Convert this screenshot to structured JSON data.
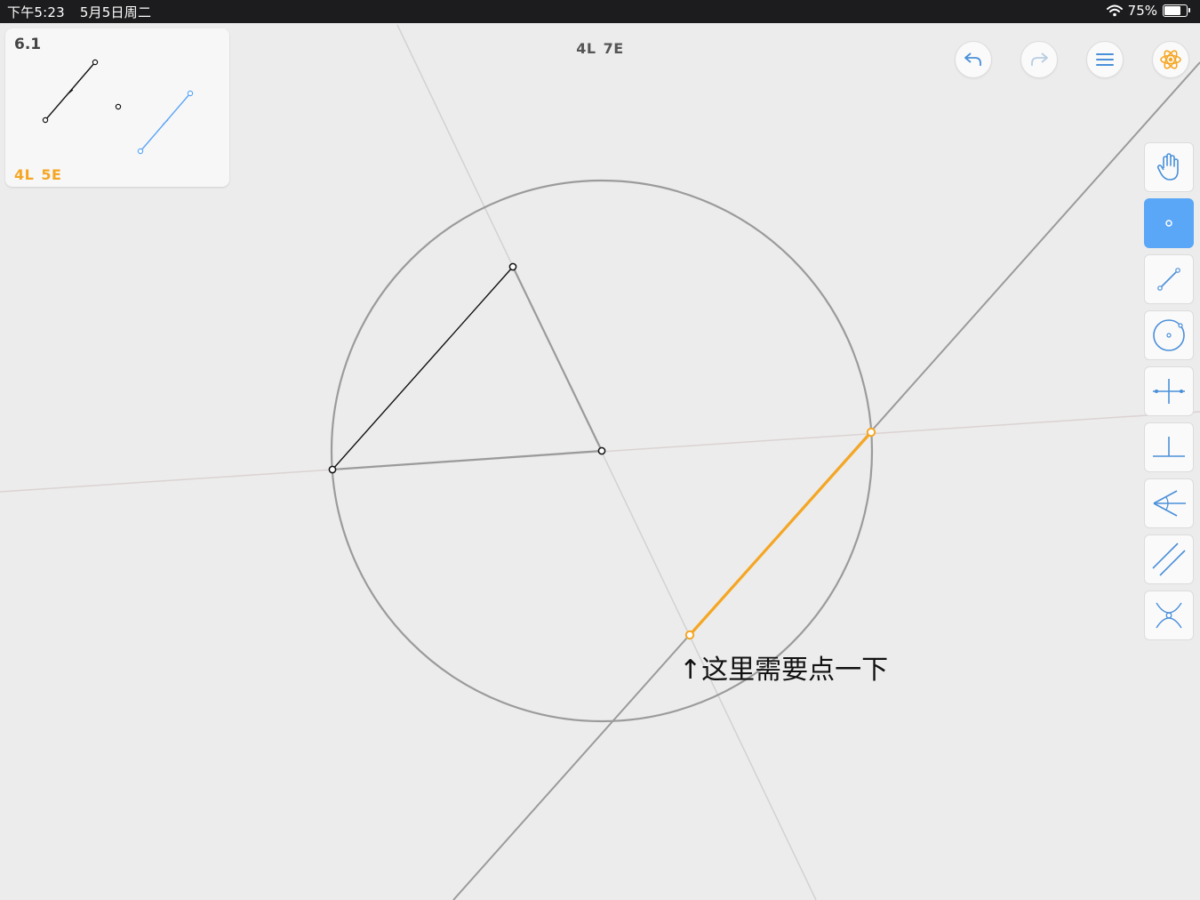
{
  "status_bar": {
    "time": "下午5:23",
    "date": "5月5日周二",
    "battery": "75%",
    "battery_level": 0.75
  },
  "level": {
    "number": "6.1",
    "target_l": "4L",
    "target_e": "5E"
  },
  "move_counter": {
    "l": "4L",
    "e": "7E"
  },
  "top_buttons": [
    {
      "name": "undo",
      "icon": "undo-arrow-icon",
      "enabled": true
    },
    {
      "name": "redo",
      "icon": "redo-arrow-icon",
      "enabled": false
    },
    {
      "name": "menu",
      "icon": "hamburger-menu-icon",
      "enabled": true
    },
    {
      "name": "hint",
      "icon": "atom-hint-icon",
      "enabled": true
    }
  ],
  "tools": [
    {
      "name": "move",
      "icon": "hand-icon",
      "active": false
    },
    {
      "name": "point",
      "icon": "point-icon",
      "active": true
    },
    {
      "name": "line",
      "icon": "line-icon",
      "active": false
    },
    {
      "name": "circle",
      "icon": "circle-icon",
      "active": false
    },
    {
      "name": "perpendicular-bisector",
      "icon": "perpendicular-bisector-icon",
      "active": false
    },
    {
      "name": "perpendicular",
      "icon": "perpendicular-icon",
      "active": false
    },
    {
      "name": "angle-bisector",
      "icon": "angle-bisector-icon",
      "active": false
    },
    {
      "name": "parallel",
      "icon": "parallel-lines-icon",
      "active": false
    },
    {
      "name": "intersect",
      "icon": "intersection-icon",
      "active": false
    }
  ],
  "annotation": "↑这里需要点一下",
  "colors": {
    "accent": "#f5a623",
    "tool_active": "#5aa6f7",
    "icon_blue": "#4a90d9",
    "construction": "#9b9b9b"
  }
}
